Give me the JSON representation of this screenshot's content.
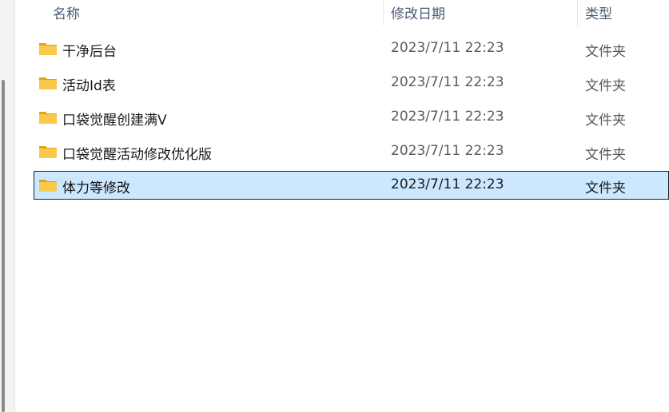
{
  "columns": {
    "name": "名称",
    "modified": "修改日期",
    "type": "类型"
  },
  "rows": [
    {
      "name": "干净后台",
      "modified": "2023/7/11 22:23",
      "type": "文件夹",
      "icon": "folder-icon"
    },
    {
      "name": "活动Id表",
      "modified": "2023/7/11 22:23",
      "type": "文件夹",
      "icon": "folder-icon"
    },
    {
      "name": "口袋觉醒创建满V",
      "modified": "2023/7/11 22:23",
      "type": "文件夹",
      "icon": "folder-icon"
    },
    {
      "name": "口袋觉醒活动修改优化版",
      "modified": "2023/7/11 22:23",
      "type": "文件夹",
      "icon": "folder-icon"
    },
    {
      "name": "体力等修改",
      "modified": "2023/7/11 22:23",
      "type": "文件夹",
      "icon": "folder-icon",
      "selected": true
    }
  ],
  "colors": {
    "selection_bg": "#cce8ff",
    "folder_yellow": "#f8c94a",
    "folder_dark": "#e3a21a"
  }
}
